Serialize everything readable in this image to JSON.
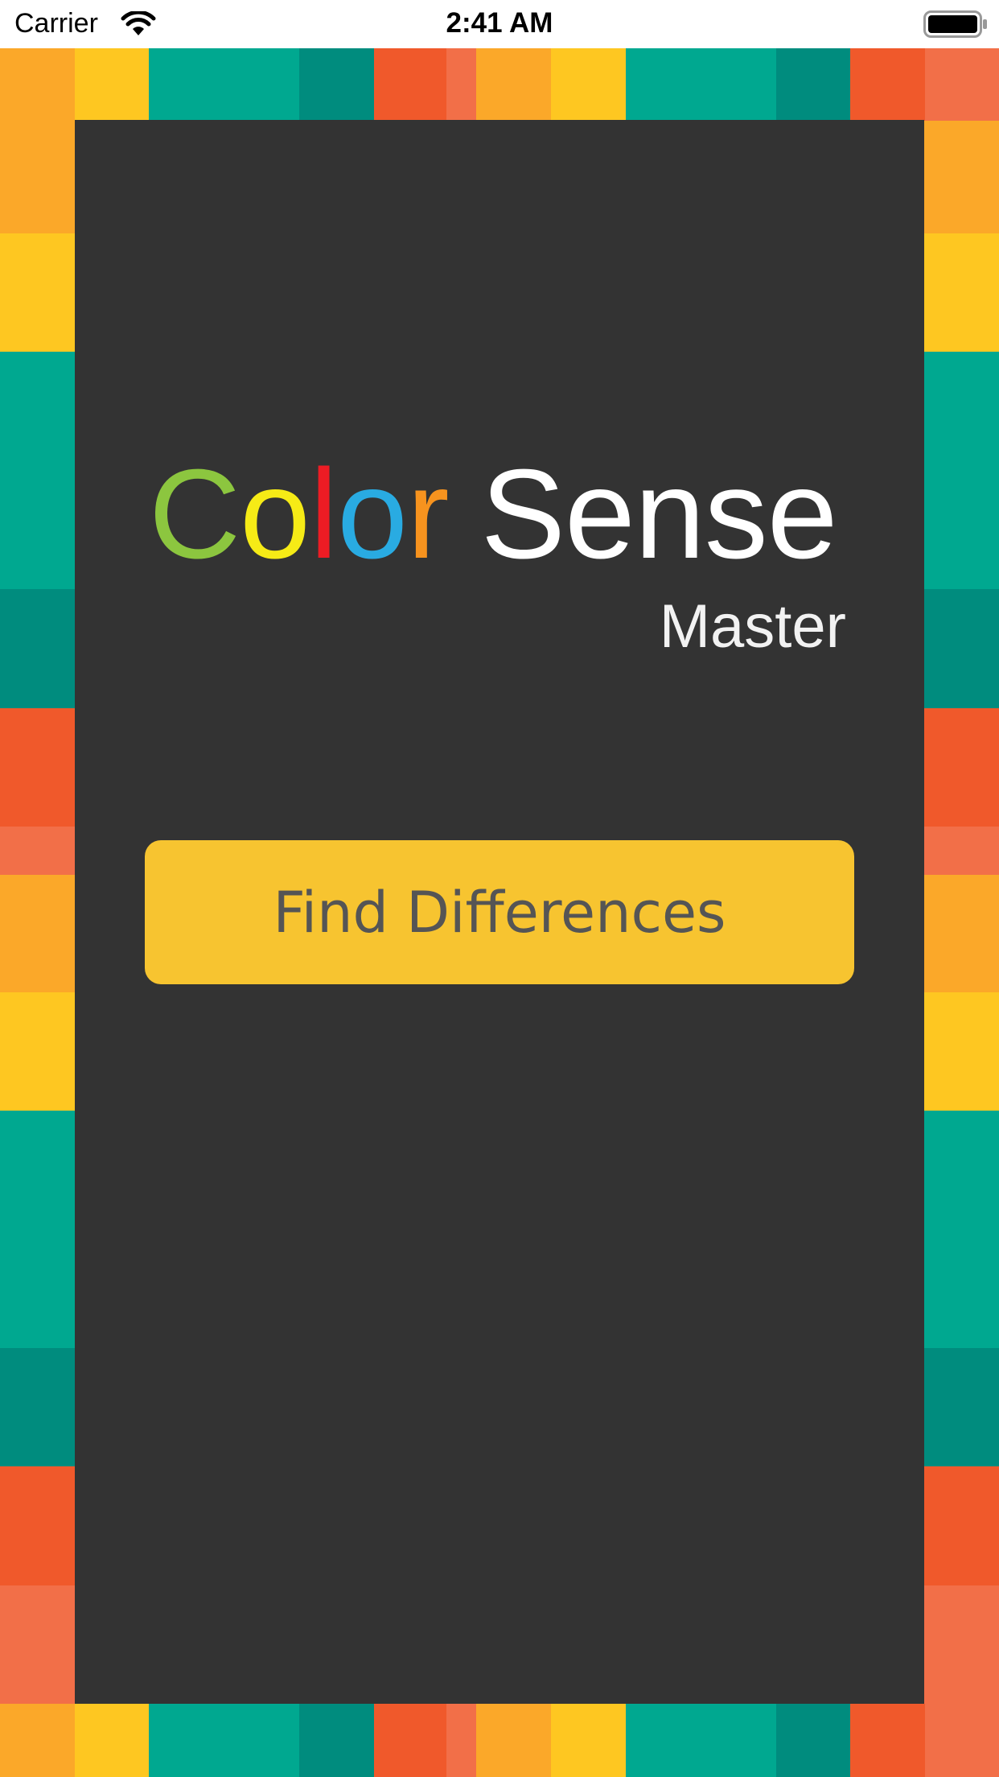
{
  "status_bar": {
    "carrier": "Carrier",
    "time": "2:41 AM",
    "wifi_icon": "wifi-icon",
    "battery_icon": "battery-icon"
  },
  "logo": {
    "letters": [
      "C",
      "o",
      "l",
      "o",
      "r"
    ],
    "word2": "Sense",
    "subtitle": "Master"
  },
  "main": {
    "button_label": "Find Differences"
  },
  "colors": {
    "panel": "#333333",
    "button": "#f7c430",
    "button_text": "#555555",
    "frame_orange": "#fba829",
    "frame_yellow": "#fec721",
    "frame_teal": "#00a890",
    "frame_dark_teal": "#008c7e",
    "frame_red": "#f0592b",
    "frame_salmon": "#f26f48"
  }
}
